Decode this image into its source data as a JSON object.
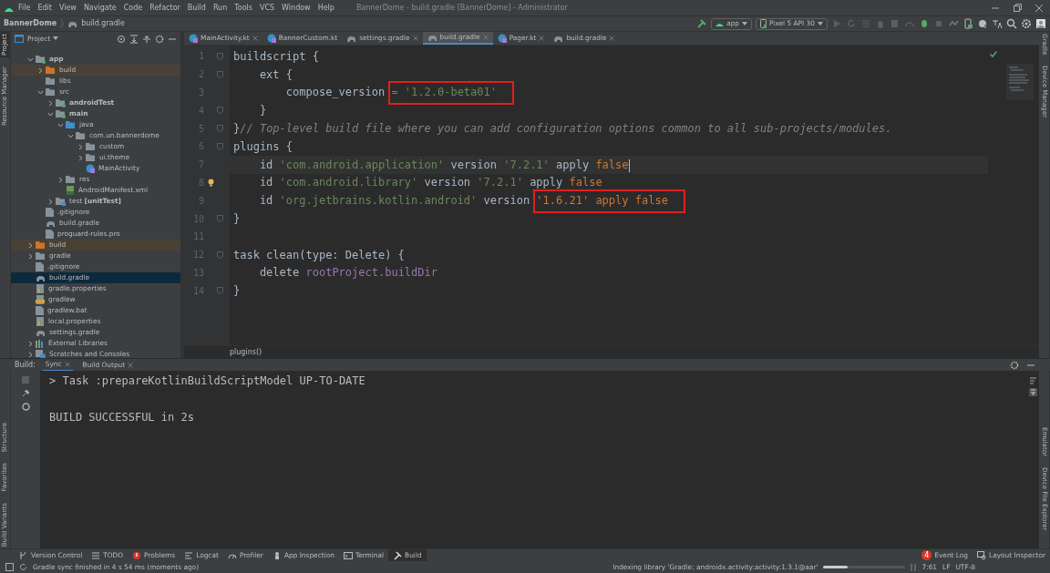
{
  "menu": [
    "File",
    "Edit",
    "View",
    "Navigate",
    "Code",
    "Refactor",
    "Build",
    "Run",
    "Tools",
    "VCS",
    "Window",
    "Help"
  ],
  "window": {
    "title": "BannerDome - build.gradle [BannerDome] - Administrator"
  },
  "breadcrumb": [
    "BannerDome",
    "build.gradle"
  ],
  "toolbar": {
    "run_config": "app",
    "device": "Pixel 5 API 30"
  },
  "left_strip": [
    {
      "label": "Project",
      "selected": true
    },
    {
      "label": "Resource Manager",
      "selected": false
    }
  ],
  "left_strip_bottom": [
    "Structure",
    "Favorites",
    "Build Variants"
  ],
  "right_strip": [
    "Gradle",
    "Device Manager"
  ],
  "right_strip_bottom": [
    "Emulator",
    "Device File Explorer"
  ],
  "project_panel": {
    "title": "Project",
    "tree": [
      {
        "label": "app",
        "kind": "module",
        "bold": true,
        "expanded": true,
        "selected": false,
        "excluded": false,
        "children": [
          {
            "label": "build",
            "kind": "excluded-folder",
            "expanded": false,
            "selected": false,
            "excluded": true
          },
          {
            "label": "libs",
            "kind": "folder",
            "selected": false,
            "excluded": false
          },
          {
            "label": "src",
            "kind": "folder",
            "expanded": true,
            "selected": false,
            "excluded": false,
            "children": [
              {
                "label": "androidTest",
                "kind": "module",
                "bold": true,
                "expanded": false,
                "selected": false,
                "excluded": false
              },
              {
                "label": "main",
                "kind": "module",
                "bold": true,
                "expanded": true,
                "selected": false,
                "excluded": false,
                "children": [
                  {
                    "label": "java",
                    "kind": "source-folder",
                    "expanded": true,
                    "selected": false,
                    "excluded": false,
                    "children": [
                      {
                        "label": "com.un.bannerdome",
                        "kind": "package",
                        "expanded": true,
                        "selected": false,
                        "excluded": false,
                        "children": [
                          {
                            "label": "custom",
                            "kind": "package",
                            "expanded": false,
                            "selected": false,
                            "excluded": false
                          },
                          {
                            "label": "ui.theme",
                            "kind": "package",
                            "expanded": false,
                            "selected": false,
                            "excluded": false
                          },
                          {
                            "label": "MainActivity",
                            "kind": "kotlin",
                            "selected": false,
                            "excluded": false
                          }
                        ]
                      }
                    ]
                  },
                  {
                    "label": "res",
                    "kind": "folder",
                    "expanded": false,
                    "selected": false,
                    "excluded": false
                  },
                  {
                    "label": "AndroidManifest.xml",
                    "kind": "xml",
                    "selected": false,
                    "excluded": false
                  }
                ]
              },
              {
                "label": "test **[unitTest]**",
                "kind": "test-folder",
                "expanded": false,
                "selected": false,
                "excluded": false
              }
            ]
          },
          {
            "label": ".gitignore",
            "kind": "file",
            "selected": false,
            "excluded": false
          },
          {
            "label": "build.gradle",
            "kind": "gradle",
            "selected": false,
            "excluded": false
          },
          {
            "label": "proguard-rules.pro",
            "kind": "file",
            "selected": false,
            "excluded": false
          }
        ]
      },
      {
        "label": "build",
        "kind": "excluded-folder",
        "expanded": false,
        "selected": false,
        "excluded": true
      },
      {
        "label": "gradle",
        "kind": "folder",
        "expanded": false,
        "selected": false,
        "excluded": false
      },
      {
        "label": ".gitignore",
        "kind": "file",
        "selected": false,
        "excluded": false
      },
      {
        "label": "build.gradle",
        "kind": "gradle",
        "selected": true,
        "excluded": false
      },
      {
        "label": "gradle.properties",
        "kind": "properties",
        "selected": false,
        "excluded": false
      },
      {
        "label": "gradlew",
        "kind": "script",
        "selected": false,
        "excluded": false
      },
      {
        "label": "gradlew.bat",
        "kind": "file",
        "selected": false,
        "excluded": false
      },
      {
        "label": "local.properties",
        "kind": "properties",
        "selected": false,
        "excluded": false
      },
      {
        "label": "settings.gradle",
        "kind": "gradle",
        "selected": false,
        "excluded": false
      },
      {
        "label": "External Libraries",
        "kind": "libraries",
        "expanded": false,
        "selected": false,
        "excluded": false
      },
      {
        "label": "Scratches and Consoles",
        "kind": "scratches",
        "expanded": false,
        "selected": false,
        "excluded": false
      }
    ]
  },
  "editor_tabs": [
    {
      "label": "MainActivity.kt",
      "kind": "kotlin",
      "selected": false,
      "closable": true
    },
    {
      "label": "BannerCustom.kt",
      "kind": "kotlin",
      "selected": false,
      "closable": false
    },
    {
      "label": "settings.gradle",
      "kind": "gradle",
      "selected": false,
      "closable": true
    },
    {
      "label": "build.gradle",
      "kind": "gradle",
      "selected": true,
      "closable": true
    },
    {
      "label": "Pager.kt",
      "kind": "kotlin",
      "selected": false,
      "closable": true
    },
    {
      "label": "build.gradle",
      "kind": "gradle",
      "selected": false,
      "closable": true
    }
  ],
  "code": [
    {
      "number": "1",
      "current": false,
      "fold": true,
      "tokens": [
        {
          "text": "buildscript {",
          "kind": "plain"
        }
      ]
    },
    {
      "number": "2",
      "current": false,
      "fold": true,
      "tokens": [
        {
          "text": "    ext {",
          "kind": "plain"
        }
      ]
    },
    {
      "number": "3",
      "current": false,
      "fold": false,
      "tokens": [
        {
          "text": "        compose_version ",
          "kind": "plain"
        },
        {
          "text": "= '1.2.0-beta01'",
          "kind": "string",
          "boxed": true
        }
      ]
    },
    {
      "number": "4",
      "current": false,
      "fold": true,
      "tokens": [
        {
          "text": "    }",
          "kind": "plain"
        }
      ]
    },
    {
      "number": "5",
      "current": false,
      "fold": true,
      "tokens": [
        {
          "text": "}",
          "kind": "plain"
        },
        {
          "text": "// Top-level build file where you can add configuration options common to all sub-projects/modules.",
          "kind": "comment"
        }
      ]
    },
    {
      "number": "6",
      "current": false,
      "fold": true,
      "tokens": [
        {
          "text": "plugins {",
          "kind": "plain"
        }
      ]
    },
    {
      "number": "7",
      "current": true,
      "fold": false,
      "tokens": [
        {
          "text": "    id ",
          "kind": "plain"
        },
        {
          "text": "'com.android.application'",
          "kind": "string"
        },
        {
          "text": " version ",
          "kind": "plain"
        },
        {
          "text": "'7.2.1'",
          "kind": "string"
        },
        {
          "text": " apply ",
          "kind": "plain"
        },
        {
          "text": "false",
          "kind": "keyword"
        }
      ]
    },
    {
      "number": "8",
      "current": false,
      "fold": false,
      "bulb": true,
      "tokens": [
        {
          "text": "    id ",
          "kind": "plain"
        },
        {
          "text": "'com.android.library'",
          "kind": "string"
        },
        {
          "text": " version ",
          "kind": "plain"
        },
        {
          "text": "'7.2.1'",
          "kind": "string"
        },
        {
          "text": " apply ",
          "kind": "plain"
        },
        {
          "text": "false",
          "kind": "keyword"
        }
      ]
    },
    {
      "number": "9",
      "current": false,
      "fold": false,
      "tokens": [
        {
          "text": "    id ",
          "kind": "plain"
        },
        {
          "text": "'org.jetbrains.kotlin.android'",
          "kind": "string"
        },
        {
          "text": " version ",
          "kind": "plain"
        },
        {
          "text": "'1.6.21' apply false",
          "kind": "mixed",
          "boxed": true
        }
      ]
    },
    {
      "number": "10",
      "current": false,
      "fold": true,
      "tokens": [
        {
          "text": "}",
          "kind": "plain"
        }
      ]
    },
    {
      "number": "11",
      "current": false,
      "fold": false
    },
    {
      "number": "12",
      "current": false,
      "fold": true,
      "tokens": [
        {
          "text": "task clean(type: Delete) {",
          "kind": "plain"
        }
      ]
    },
    {
      "number": "13",
      "current": false,
      "fold": false,
      "tokens": [
        {
          "text": "    delete ",
          "kind": "plain"
        },
        {
          "text": "rootProject.buildDir",
          "kind": "field"
        }
      ]
    },
    {
      "number": "14",
      "current": false,
      "fold": true,
      "tokens": [
        {
          "text": "}",
          "kind": "plain"
        }
      ]
    }
  ],
  "editor_breadcrumb": "plugins()",
  "build_panel": {
    "label": "Build:",
    "tabs": [
      {
        "label": "Sync",
        "selected": true
      },
      {
        "label": "Build Output",
        "selected": false
      }
    ],
    "output": [
      "> Task :prepareKotlinBuildScriptModel UP-TO-DATE",
      "BUILD SUCCESSFUL in 2s"
    ]
  },
  "tool_tabs": [
    {
      "label": "Version Control",
      "kind": "branch",
      "selected": false
    },
    {
      "label": "TODO",
      "kind": "list",
      "selected": false
    },
    {
      "label": "Problems",
      "kind": "error",
      "selected": false
    },
    {
      "label": "Logcat",
      "kind": "lines",
      "selected": false
    },
    {
      "label": "Profiler",
      "kind": "gauge",
      "selected": false
    },
    {
      "label": "App Inspection",
      "kind": "inspect",
      "selected": false
    },
    {
      "label": "Terminal",
      "kind": "terminal",
      "selected": false
    },
    {
      "label": "Build",
      "kind": "hammer",
      "selected": true
    }
  ],
  "tool_tabs_right": [
    {
      "label": "Event Log",
      "badge": "4"
    },
    {
      "label": "Layout Inspector"
    }
  ],
  "status_bar": {
    "message": "Gradle sync finished in 4 s 54 ms (moments ago)",
    "indexing": "Indexing library 'Gradle: androidx.activity:activity:1.3.1@aar'",
    "level": 0.3,
    "position": "7:61",
    "line_separator": "LF",
    "encoding": "UTF-8"
  }
}
